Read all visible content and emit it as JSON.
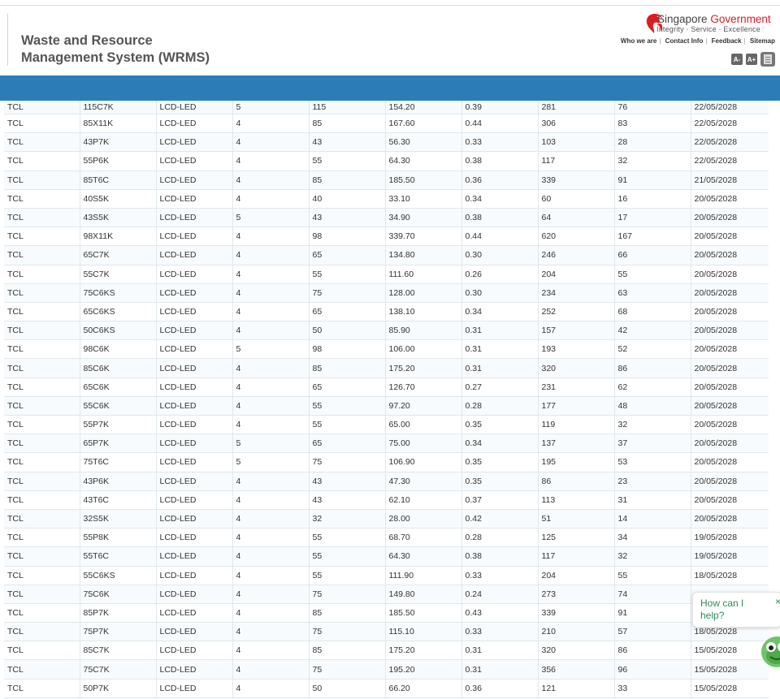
{
  "header": {
    "title_line1": "Waste and Resource",
    "title_line2": "Management System (WRMS)"
  },
  "gov": {
    "name_part1": "Singapore",
    "name_part2": "Government",
    "tagline": "Integrity · Service · Excellence",
    "brand_color": "#e01a22"
  },
  "toplinks": [
    "Who we are",
    "Contact Info",
    "Feedback",
    "Sitemap"
  ],
  "font_controls": {
    "decrease": "A-",
    "increase": "A+",
    "print_icon": "print-icon"
  },
  "colors": {
    "bar": "#2a7db7"
  },
  "rows": [
    [
      "TCL",
      "115C7K",
      "LCD-LED",
      "5",
      "115",
      "154.20",
      "0.39",
      "281",
      "76",
      "22/05/2028"
    ],
    [
      "TCL",
      "85X11K",
      "LCD-LED",
      "4",
      "85",
      "167.60",
      "0.44",
      "306",
      "83",
      "22/05/2028"
    ],
    [
      "TCL",
      "43P7K",
      "LCD-LED",
      "4",
      "43",
      "56.30",
      "0.33",
      "103",
      "28",
      "22/05/2028"
    ],
    [
      "TCL",
      "55P6K",
      "LCD-LED",
      "4",
      "55",
      "64.30",
      "0.38",
      "117",
      "32",
      "22/05/2028"
    ],
    [
      "TCL",
      "85T6C",
      "LCD-LED",
      "4",
      "85",
      "185.50",
      "0.36",
      "339",
      "91",
      "21/05/2028"
    ],
    [
      "TCL",
      "40S5K",
      "LCD-LED",
      "4",
      "40",
      "33.10",
      "0.34",
      "60",
      "16",
      "20/05/2028"
    ],
    [
      "TCL",
      "43S5K",
      "LCD-LED",
      "5",
      "43",
      "34.90",
      "0.38",
      "64",
      "17",
      "20/05/2028"
    ],
    [
      "TCL",
      "98X11K",
      "LCD-LED",
      "4",
      "98",
      "339.70",
      "0.44",
      "620",
      "167",
      "20/05/2028"
    ],
    [
      "TCL",
      "65C7K",
      "LCD-LED",
      "4",
      "65",
      "134.80",
      "0.30",
      "246",
      "66",
      "20/05/2028"
    ],
    [
      "TCL",
      "55C7K",
      "LCD-LED",
      "4",
      "55",
      "111.60",
      "0.26",
      "204",
      "55",
      "20/05/2028"
    ],
    [
      "TCL",
      "75C6KS",
      "LCD-LED",
      "4",
      "75",
      "128.00",
      "0.30",
      "234",
      "63",
      "20/05/2028"
    ],
    [
      "TCL",
      "65C6KS",
      "LCD-LED",
      "4",
      "65",
      "138.10",
      "0.34",
      "252",
      "68",
      "20/05/2028"
    ],
    [
      "TCL",
      "50C6KS",
      "LCD-LED",
      "4",
      "50",
      "85.90",
      "0.31",
      "157",
      "42",
      "20/05/2028"
    ],
    [
      "TCL",
      "98C6K",
      "LCD-LED",
      "5",
      "98",
      "106.00",
      "0.31",
      "193",
      "52",
      "20/05/2028"
    ],
    [
      "TCL",
      "85C6K",
      "LCD-LED",
      "4",
      "85",
      "175.20",
      "0.31",
      "320",
      "86",
      "20/05/2028"
    ],
    [
      "TCL",
      "65C6K",
      "LCD-LED",
      "4",
      "65",
      "126.70",
      "0.27",
      "231",
      "62",
      "20/05/2028"
    ],
    [
      "TCL",
      "55C6K",
      "LCD-LED",
      "4",
      "55",
      "97.20",
      "0.28",
      "177",
      "48",
      "20/05/2028"
    ],
    [
      "TCL",
      "55P7K",
      "LCD-LED",
      "4",
      "55",
      "65.00",
      "0.35",
      "119",
      "32",
      "20/05/2028"
    ],
    [
      "TCL",
      "65P7K",
      "LCD-LED",
      "5",
      "65",
      "75.00",
      "0.34",
      "137",
      "37",
      "20/05/2028"
    ],
    [
      "TCL",
      "75T6C",
      "LCD-LED",
      "5",
      "75",
      "106.90",
      "0.35",
      "195",
      "53",
      "20/05/2028"
    ],
    [
      "TCL",
      "43P6K",
      "LCD-LED",
      "4",
      "43",
      "47.30",
      "0.35",
      "86",
      "23",
      "20/05/2028"
    ],
    [
      "TCL",
      "43T6C",
      "LCD-LED",
      "4",
      "43",
      "62.10",
      "0.37",
      "113",
      "31",
      "20/05/2028"
    ],
    [
      "TCL",
      "32S5K",
      "LCD-LED",
      "4",
      "32",
      "28.00",
      "0.42",
      "51",
      "14",
      "20/05/2028"
    ],
    [
      "TCL",
      "55P8K",
      "LCD-LED",
      "4",
      "55",
      "68.70",
      "0.28",
      "125",
      "34",
      "19/05/2028"
    ],
    [
      "TCL",
      "55T6C",
      "LCD-LED",
      "4",
      "55",
      "64.30",
      "0.38",
      "117",
      "32",
      "19/05/2028"
    ],
    [
      "TCL",
      "55C6KS",
      "LCD-LED",
      "4",
      "55",
      "111.90",
      "0.33",
      "204",
      "55",
      "18/05/2028"
    ],
    [
      "TCL",
      "75C6K",
      "LCD-LED",
      "4",
      "75",
      "149.80",
      "0.24",
      "273",
      "74",
      ""
    ],
    [
      "TCL",
      "85P7K",
      "LCD-LED",
      "4",
      "85",
      "185.50",
      "0.43",
      "339",
      "91",
      ""
    ],
    [
      "TCL",
      "75P7K",
      "LCD-LED",
      "4",
      "75",
      "115.10",
      "0.33",
      "210",
      "57",
      "18/05/2028"
    ],
    [
      "TCL",
      "85C7K",
      "LCD-LED",
      "4",
      "85",
      "175.20",
      "0.31",
      "320",
      "86",
      "15/05/2028"
    ],
    [
      "TCL",
      "75C7K",
      "LCD-LED",
      "4",
      "75",
      "195.20",
      "0.31",
      "356",
      "96",
      "15/05/2028"
    ],
    [
      "TCL",
      "50P7K",
      "LCD-LED",
      "4",
      "50",
      "66.20",
      "0.36",
      "121",
      "33",
      "15/05/2028"
    ]
  ],
  "chat": {
    "text": "How can I help?",
    "close": "×",
    "avatar_icon": "chatbot-avatar-icon"
  }
}
